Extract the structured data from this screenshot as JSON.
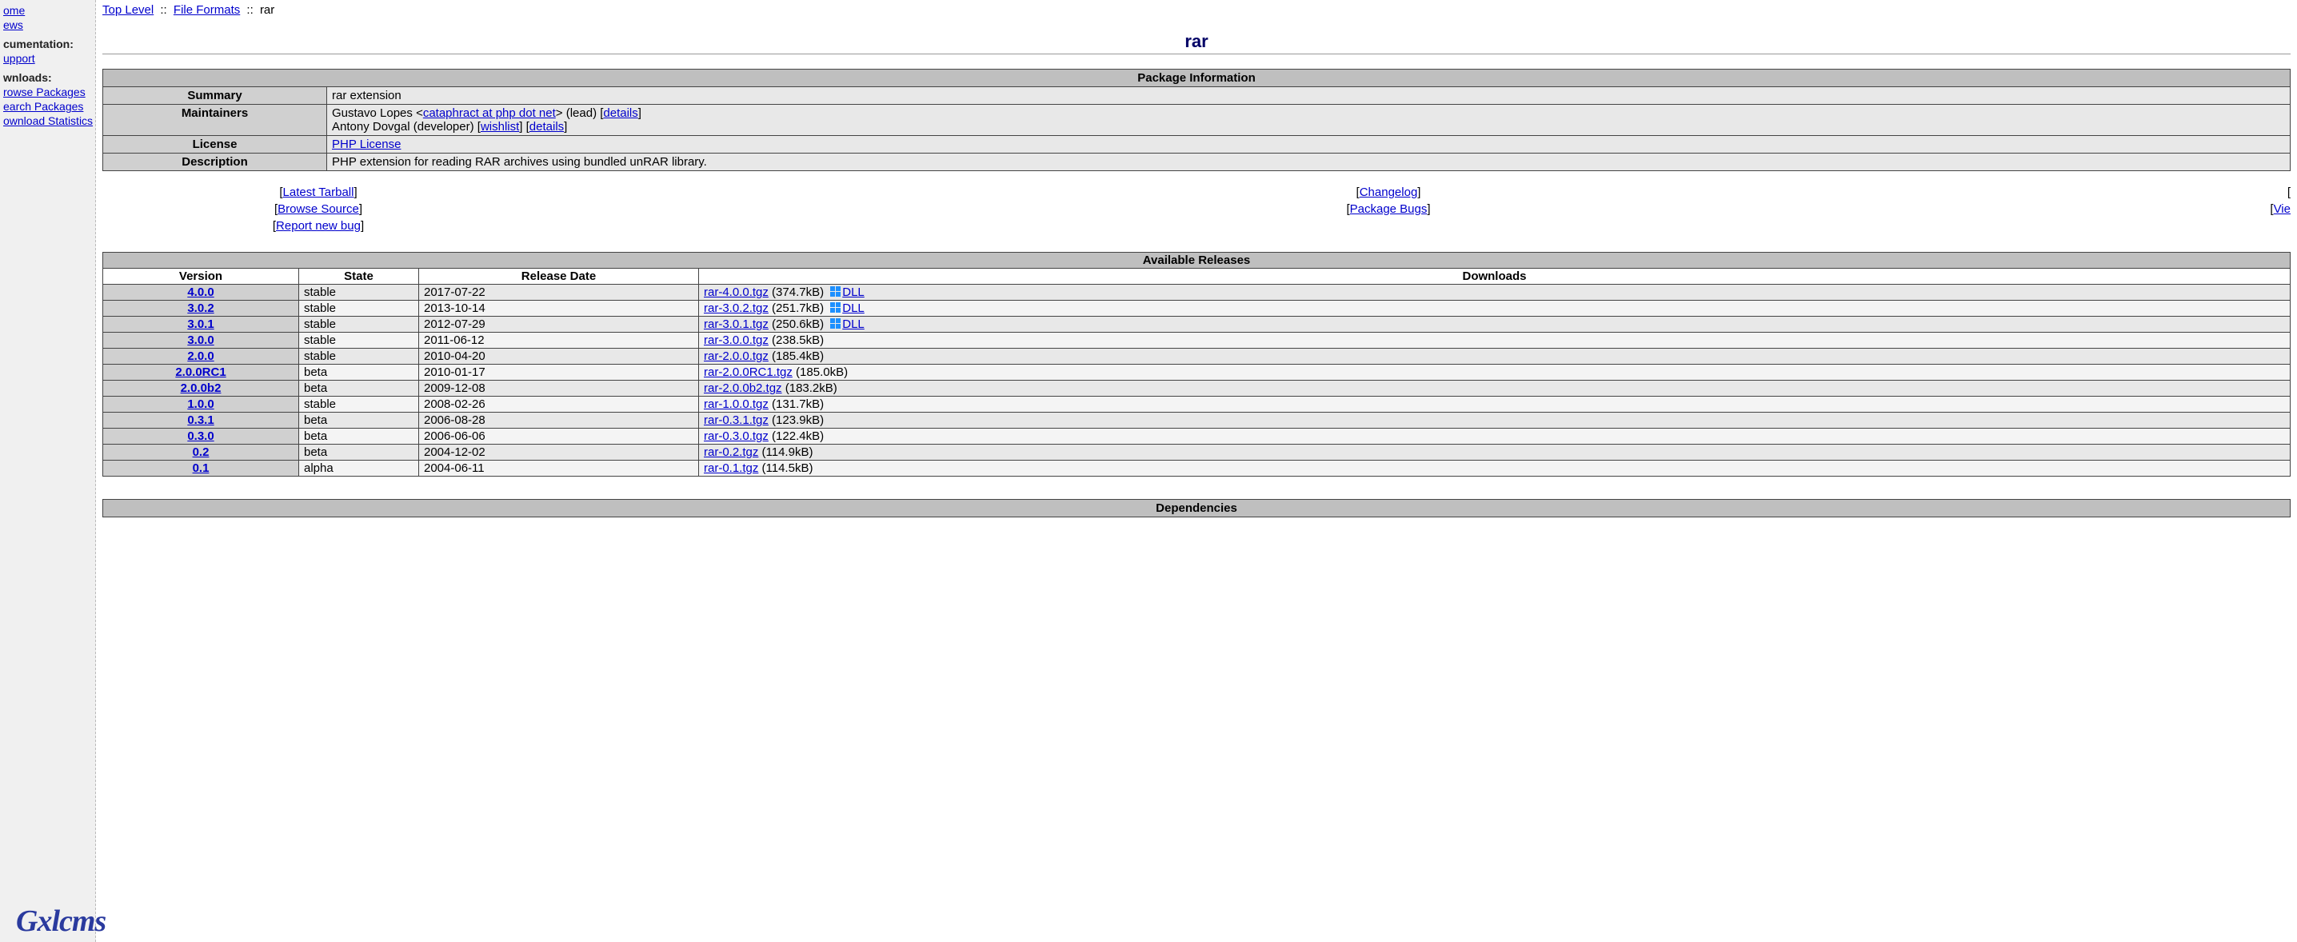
{
  "sidebar": {
    "top": [
      {
        "label": "ome"
      },
      {
        "label": "ews"
      }
    ],
    "doc_head": "cumentation:",
    "doc_items": [
      {
        "label": "upport"
      }
    ],
    "dl_head": "wnloads:",
    "dl_items": [
      {
        "label": "rowse Packages"
      },
      {
        "label": "earch Packages"
      },
      {
        "label": "ownload Statistics"
      }
    ]
  },
  "breadcrumb": {
    "top": "Top Level",
    "sep": "::",
    "cat": "File Formats",
    "current": "rar"
  },
  "title": "rar",
  "pkg": {
    "title": "Package Information",
    "summary_label": "Summary",
    "summary_value": "rar extension",
    "maintainers_label": "Maintainers",
    "maintainers_line1_pre": "Gustavo Lopes <",
    "maintainers_email": "cataphract at php dot net",
    "maintainers_line1_post": "> (lead) [",
    "maintainers_details1": "details",
    "maintainers_line1_end": "]",
    "maintainers_line2_pre": "Antony Dovgal (developer) [",
    "maintainers_wishlist": "wishlist",
    "maintainers_line2_mid": "] [",
    "maintainers_details2": "details",
    "maintainers_line2_end": "]",
    "license_label": "License",
    "license_value": "PHP License",
    "desc_label": "Description",
    "desc_value": "PHP extension for reading RAR archives using bundled unRAR library."
  },
  "links": {
    "rows": [
      {
        "a": "Latest Tarball",
        "b": "Changelog",
        "c": ""
      },
      {
        "a": "Browse Source",
        "b": "Package Bugs",
        "c": "Vie"
      },
      {
        "a": "Report new bug",
        "b": "",
        "c": ""
      }
    ],
    "lb": "[ ",
    "rb": " ]"
  },
  "releases": {
    "title": "Available Releases",
    "headers": {
      "version": "Version",
      "state": "State",
      "date": "Release Date",
      "downloads": "Downloads"
    },
    "dll_label": "DLL",
    "rows": [
      {
        "version": "4.0.0",
        "state": "stable",
        "date": "2017-07-22",
        "tgz": "rar-4.0.0.tgz",
        "size": "(374.7kB)",
        "dll": true
      },
      {
        "version": "3.0.2",
        "state": "stable",
        "date": "2013-10-14",
        "tgz": "rar-3.0.2.tgz",
        "size": "(251.7kB)",
        "dll": true
      },
      {
        "version": "3.0.1",
        "state": "stable",
        "date": "2012-07-29",
        "tgz": "rar-3.0.1.tgz",
        "size": "(250.6kB)",
        "dll": true
      },
      {
        "version": "3.0.0",
        "state": "stable",
        "date": "2011-06-12",
        "tgz": "rar-3.0.0.tgz",
        "size": "(238.5kB)",
        "dll": false
      },
      {
        "version": "2.0.0",
        "state": "stable",
        "date": "2010-04-20",
        "tgz": "rar-2.0.0.tgz",
        "size": "(185.4kB)",
        "dll": false
      },
      {
        "version": "2.0.0RC1",
        "state": "beta",
        "date": "2010-01-17",
        "tgz": "rar-2.0.0RC1.tgz",
        "size": "(185.0kB)",
        "dll": false
      },
      {
        "version": "2.0.0b2",
        "state": "beta",
        "date": "2009-12-08",
        "tgz": "rar-2.0.0b2.tgz",
        "size": "(183.2kB)",
        "dll": false
      },
      {
        "version": "1.0.0",
        "state": "stable",
        "date": "2008-02-26",
        "tgz": "rar-1.0.0.tgz",
        "size": "(131.7kB)",
        "dll": false
      },
      {
        "version": "0.3.1",
        "state": "beta",
        "date": "2006-08-28",
        "tgz": "rar-0.3.1.tgz",
        "size": "(123.9kB)",
        "dll": false
      },
      {
        "version": "0.3.0",
        "state": "beta",
        "date": "2006-06-06",
        "tgz": "rar-0.3.0.tgz",
        "size": "(122.4kB)",
        "dll": false
      },
      {
        "version": "0.2",
        "state": "beta",
        "date": "2004-12-02",
        "tgz": "rar-0.2.tgz",
        "size": "(114.9kB)",
        "dll": false
      },
      {
        "version": "0.1",
        "state": "alpha",
        "date": "2004-06-11",
        "tgz": "rar-0.1.tgz",
        "size": "(114.5kB)",
        "dll": false
      }
    ]
  },
  "deps": {
    "title": "Dependencies"
  },
  "watermark": "Gxlcms"
}
